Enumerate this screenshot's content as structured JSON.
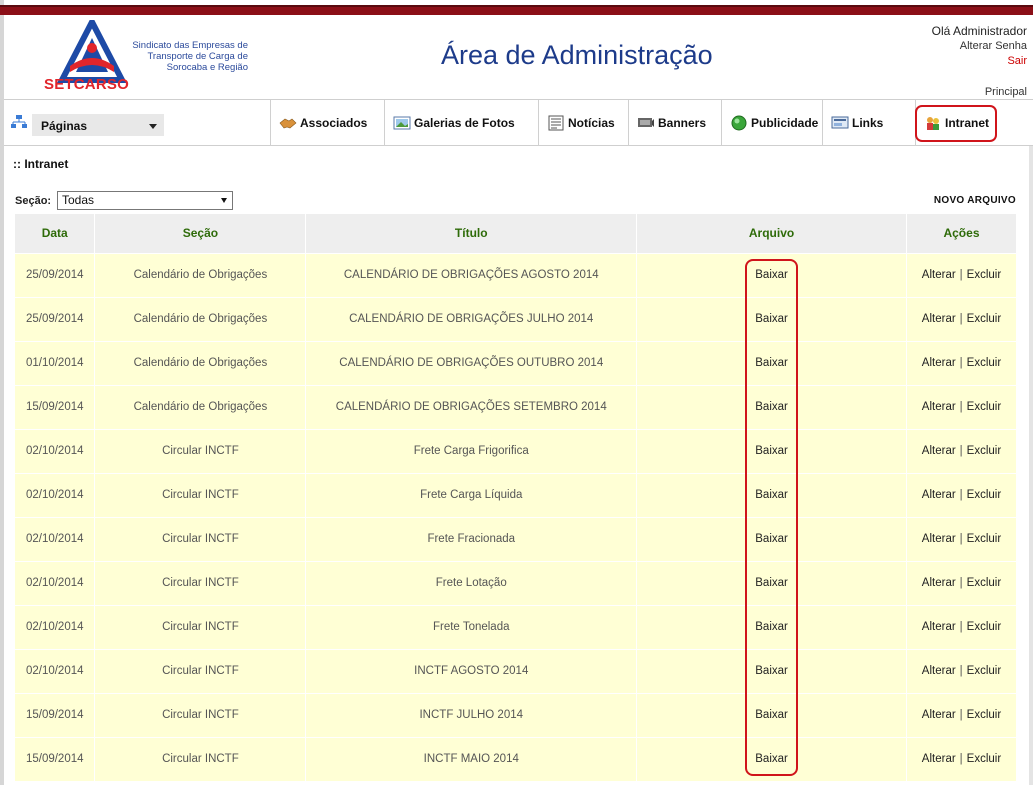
{
  "header": {
    "logo_text": "Sindicato das Empresas de Transporte de Carga de Sorocaba e Região",
    "logo_brand": "SETCARSO",
    "title": "Área de Administração",
    "greeting": "Olá Administrador",
    "change_password": "Alterar Senha",
    "logout": "Sair",
    "principal": "Principal"
  },
  "nav": {
    "pages_select": "Páginas",
    "items": [
      {
        "label": "Associados",
        "icon": "handshake-icon"
      },
      {
        "label": "Galerias de Fotos",
        "icon": "photo-gallery-icon"
      },
      {
        "label": "Notícias",
        "icon": "news-icon"
      },
      {
        "label": "Banners",
        "icon": "banner-icon"
      },
      {
        "label": "Publicidade",
        "icon": "publicity-icon"
      },
      {
        "label": "Links",
        "icon": "links-icon"
      },
      {
        "label": "Intranet",
        "icon": "intranet-icon"
      }
    ]
  },
  "breadcrumb": ":: Intranet",
  "filter": {
    "section_label": "Seção:",
    "section_value": "Todas",
    "new_file": "NOVO ARQUIVO"
  },
  "table": {
    "headers": [
      "Data",
      "Seção",
      "Título",
      "Arquivo",
      "Ações"
    ],
    "rows": [
      {
        "date": "25/09/2014",
        "section": "Calendário de Obrigações",
        "title": "CALENDÁRIO DE OBRIGAÇÕES AGOSTO 2014",
        "file": "Baixar",
        "edit": "Alterar",
        "delete": "Excluir"
      },
      {
        "date": "25/09/2014",
        "section": "Calendário de Obrigações",
        "title": "CALENDÁRIO DE OBRIGAÇÕES JULHO 2014",
        "file": "Baixar",
        "edit": "Alterar",
        "delete": "Excluir"
      },
      {
        "date": "01/10/2014",
        "section": "Calendário de Obrigações",
        "title": "CALENDÁRIO DE OBRIGAÇÕES OUTUBRO 2014",
        "file": "Baixar",
        "edit": "Alterar",
        "delete": "Excluir"
      },
      {
        "date": "15/09/2014",
        "section": "Calendário de Obrigações",
        "title": "CALENDÁRIO DE OBRIGAÇÕES SETEMBRO 2014",
        "file": "Baixar",
        "edit": "Alterar",
        "delete": "Excluir"
      },
      {
        "date": "02/10/2014",
        "section": "Circular INCTF",
        "title": "Frete Carga Frigorifica",
        "file": "Baixar",
        "edit": "Alterar",
        "delete": "Excluir"
      },
      {
        "date": "02/10/2014",
        "section": "Circular INCTF",
        "title": "Frete Carga Líquida",
        "file": "Baixar",
        "edit": "Alterar",
        "delete": "Excluir"
      },
      {
        "date": "02/10/2014",
        "section": "Circular INCTF",
        "title": "Frete Fracionada",
        "file": "Baixar",
        "edit": "Alterar",
        "delete": "Excluir"
      },
      {
        "date": "02/10/2014",
        "section": "Circular INCTF",
        "title": "Frete Lotação",
        "file": "Baixar",
        "edit": "Alterar",
        "delete": "Excluir"
      },
      {
        "date": "02/10/2014",
        "section": "Circular INCTF",
        "title": "Frete Tonelada",
        "file": "Baixar",
        "edit": "Alterar",
        "delete": "Excluir"
      },
      {
        "date": "02/10/2014",
        "section": "Circular INCTF",
        "title": "INCTF AGOSTO 2014",
        "file": "Baixar",
        "edit": "Alterar",
        "delete": "Excluir"
      },
      {
        "date": "15/09/2014",
        "section": "Circular INCTF",
        "title": "INCTF JULHO 2014",
        "file": "Baixar",
        "edit": "Alterar",
        "delete": "Excluir"
      },
      {
        "date": "15/09/2014",
        "section": "Circular INCTF",
        "title": "INCTF MAIO 2014",
        "file": "Baixar",
        "edit": "Alterar",
        "delete": "Excluir"
      }
    ]
  },
  "colors": {
    "top_bar": "#8b0f17",
    "title": "#1d3b8a",
    "header_text": "#2e6b09",
    "row_bg": "#ffffd5",
    "highlight": "#d0141b"
  }
}
